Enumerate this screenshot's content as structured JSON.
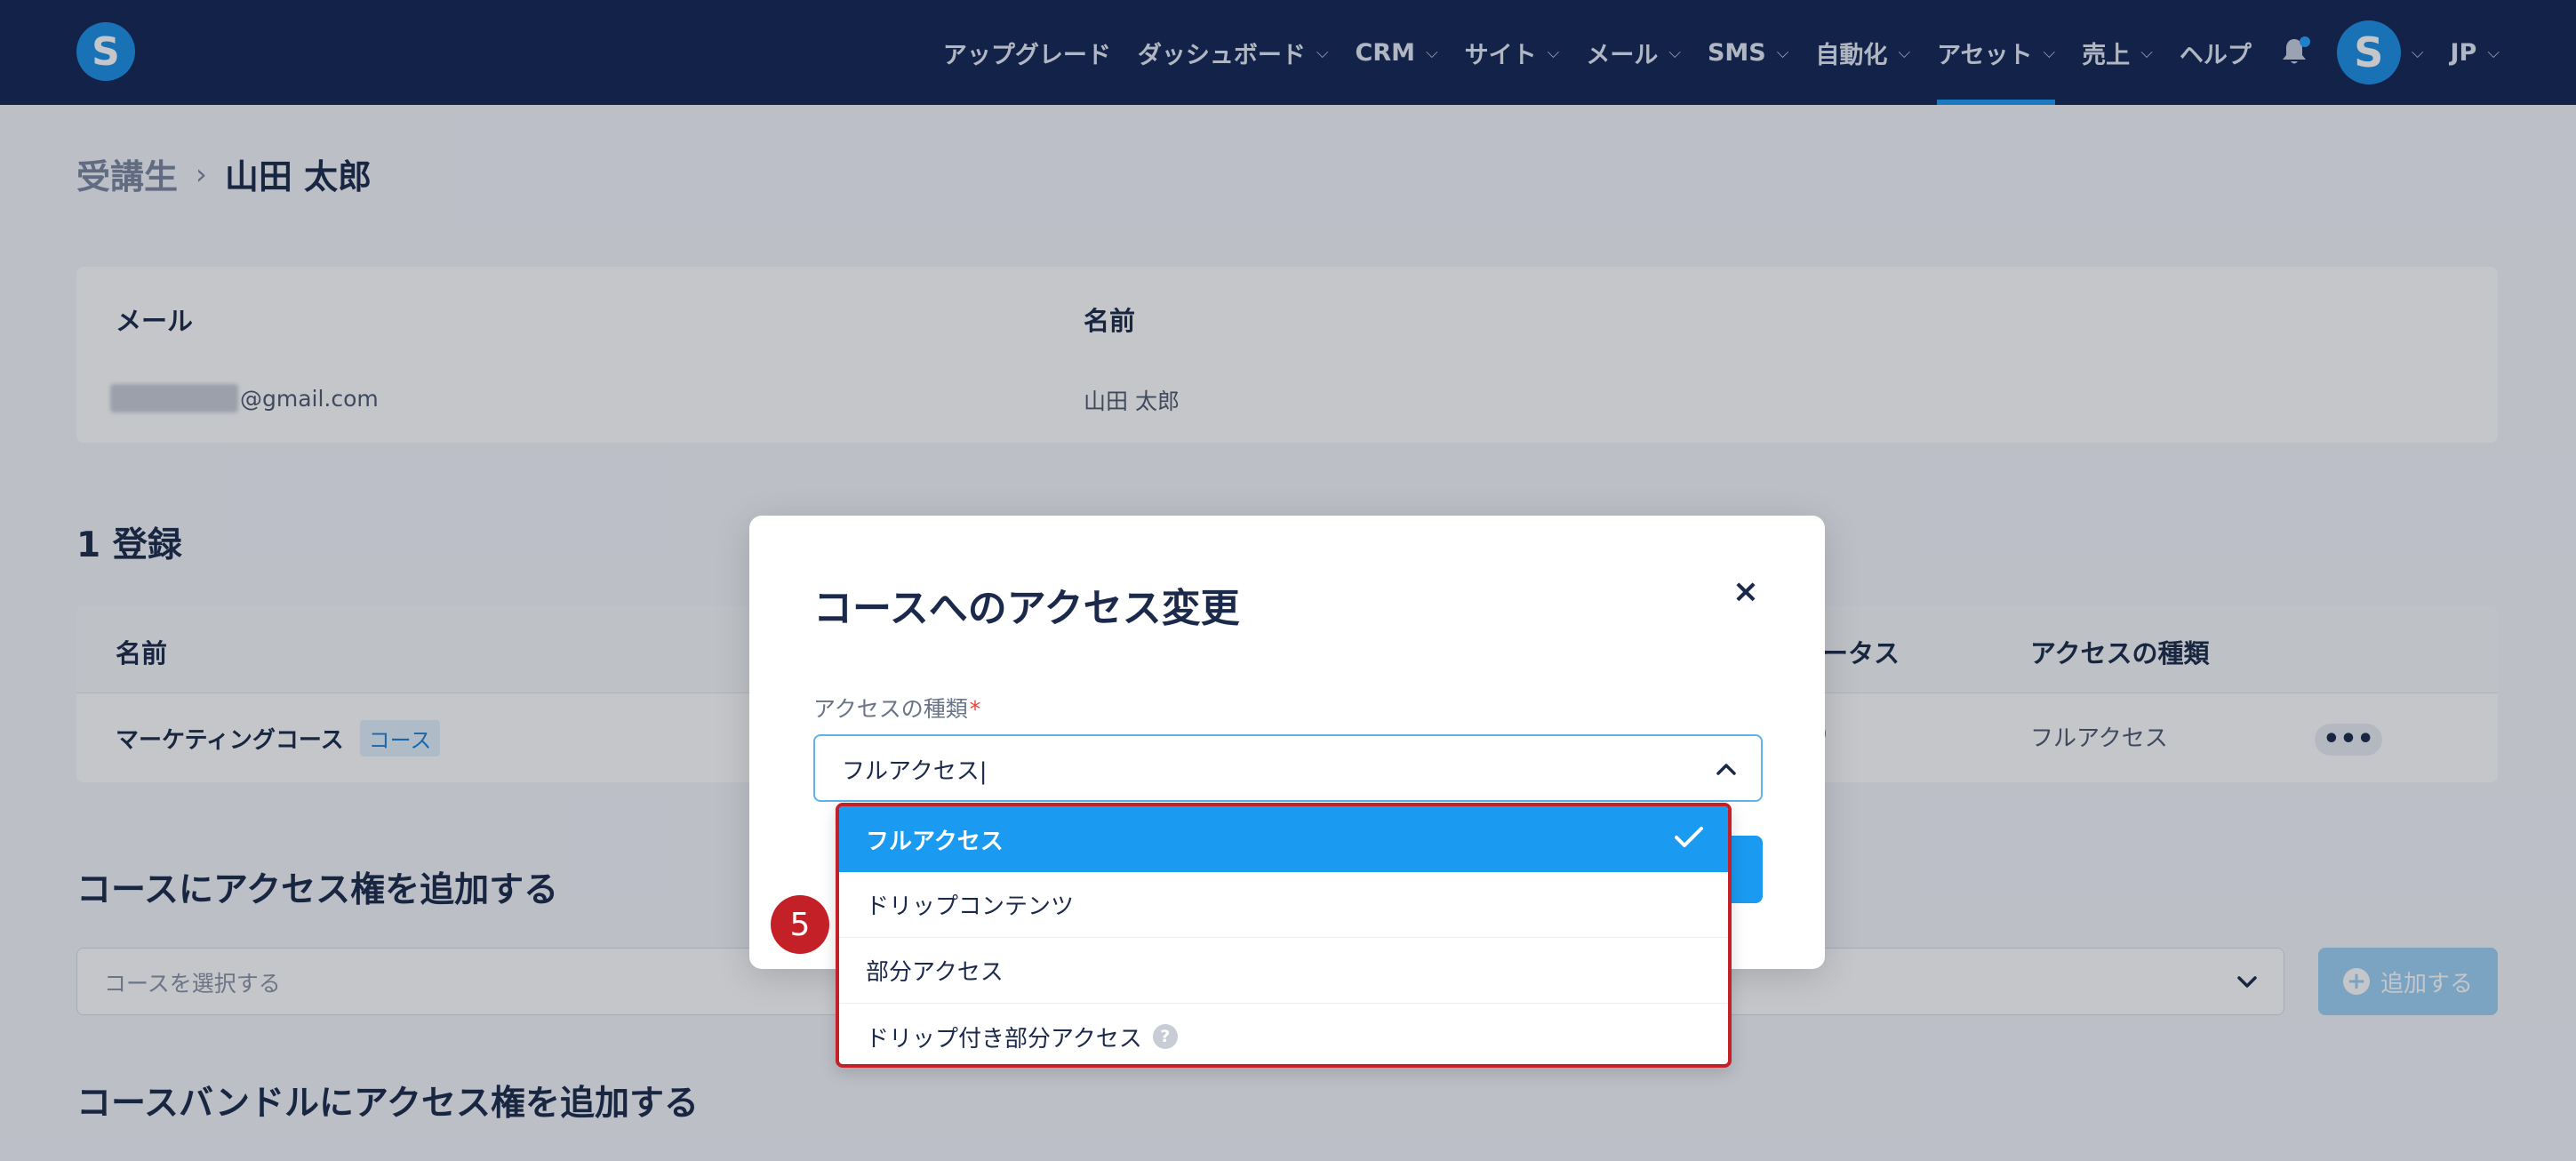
{
  "nav": {
    "logo": "S",
    "items": [
      {
        "label": "アップグレード",
        "has_menu": false
      },
      {
        "label": "ダッシュボード",
        "has_menu": true
      },
      {
        "label": "CRM",
        "has_menu": true
      },
      {
        "label": "サイト",
        "has_menu": true
      },
      {
        "label": "メール",
        "has_menu": true
      },
      {
        "label": "SMS",
        "has_menu": true
      },
      {
        "label": "自動化",
        "has_menu": true
      },
      {
        "label": "アセット",
        "has_menu": true,
        "active": true
      },
      {
        "label": "売上",
        "has_menu": true
      },
      {
        "label": "ヘルプ",
        "has_menu": false
      }
    ],
    "avatar": "S",
    "language": "JP"
  },
  "breadcrumb": {
    "parent": "受講生",
    "separator": "›",
    "current": "山田 太郎"
  },
  "student_info": {
    "email_label": "メール",
    "email_value": "@gmail.com",
    "name_label": "名前",
    "name_value": "山田 太郎"
  },
  "enrollments": {
    "title": "1 登録",
    "columns": {
      "name": "名前",
      "status": "ータス",
      "access_type": "アクセスの種類"
    },
    "rows": [
      {
        "name": "マーケティングコース",
        "tag": "コース",
        "access_type": "フルアクセス"
      }
    ],
    "more_label": "•••"
  },
  "add_course": {
    "title": "コースにアクセス権を追加する",
    "placeholder": "コースを選択する",
    "button_label": "追加する"
  },
  "add_bundle": {
    "title": "コースバンドルにアクセス権を追加する"
  },
  "modal": {
    "title": "コースへのアクセス変更",
    "close_label": "×",
    "field_label": "アクセスの種類",
    "required_mark": "*",
    "field_value": "フルアクセス|",
    "options": [
      {
        "label": "フルアクセス",
        "selected": true
      },
      {
        "label": "ドリップコンテンツ",
        "selected": false
      },
      {
        "label": "部分アクセス",
        "selected": false
      },
      {
        "label": "ドリップ付き部分アクセス",
        "selected": false,
        "help": "?"
      }
    ]
  },
  "step_badge": "5",
  "colors": {
    "nav_bg": "#132552",
    "accent": "#1a9af0",
    "highlight": "#c42027",
    "status_green": "#2bb673"
  }
}
